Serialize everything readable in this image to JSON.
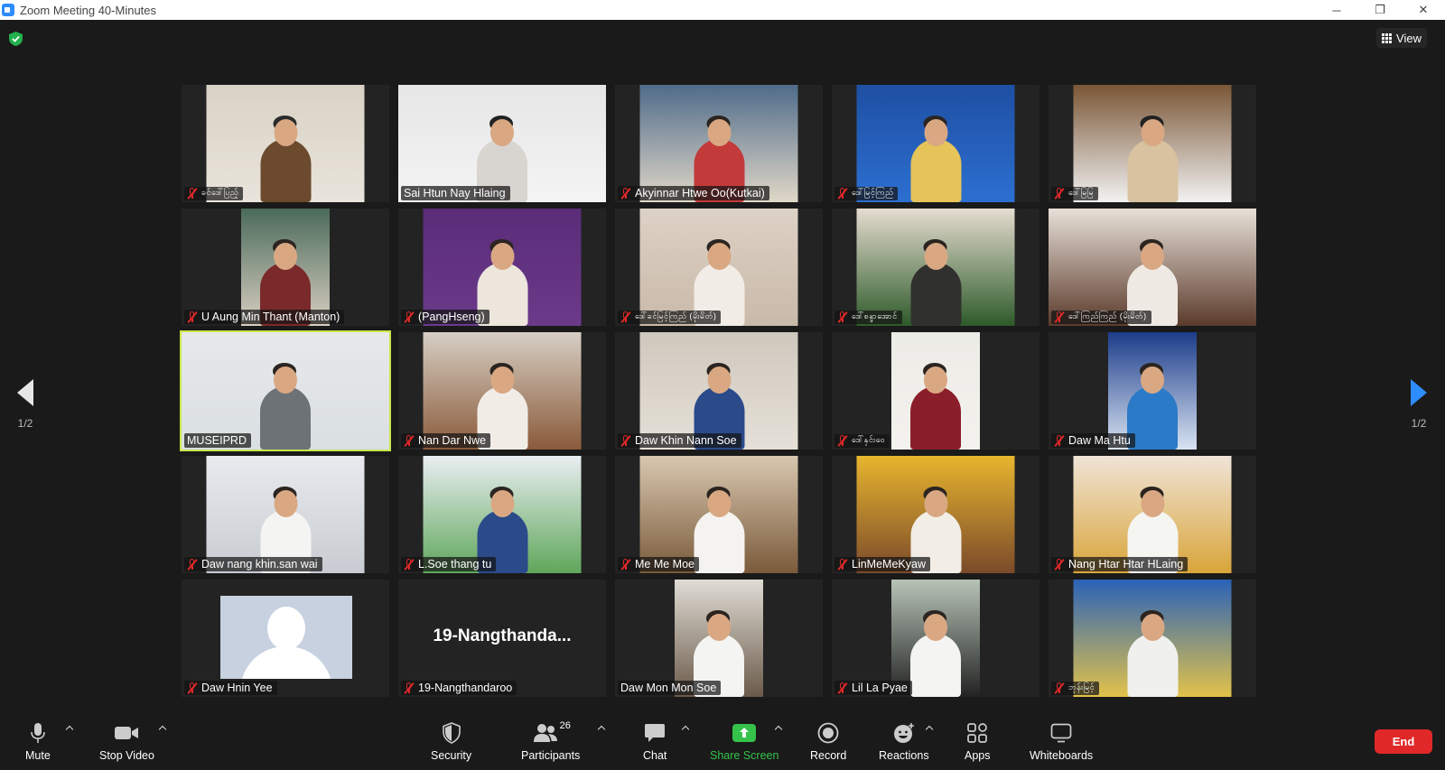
{
  "window": {
    "title": "Zoom Meeting 40-Minutes",
    "minimize": "─",
    "maximize": "❐",
    "close": "✕"
  },
  "header": {
    "view_label": "View"
  },
  "pagination": {
    "left": "1/2",
    "right": "1/2"
  },
  "participants": [
    {
      "name": "ခင်ဒေါ်ပြည့်",
      "muted": true,
      "script": true
    },
    {
      "name": "Sai Htun Nay Hlaing",
      "muted": false
    },
    {
      "name": "Akyinnar Htwe Oo(Kutkai)",
      "muted": true
    },
    {
      "name": "ဒေါ်မြင့်ကြည်",
      "muted": true,
      "script": true
    },
    {
      "name": "ဒေါ်မြမြ",
      "muted": true,
      "script": true
    },
    {
      "name": "U Aung Min Thant (Manton)",
      "muted": true
    },
    {
      "name": "(PangHseng)",
      "muted": true
    },
    {
      "name": "ဒေါ်ခင်မြင့်ကြည် (မိုးမိတ်)",
      "muted": true,
      "script": true
    },
    {
      "name": "ဒေါ်စန္ဒာအောင်",
      "muted": true,
      "script": true
    },
    {
      "name": "ဒေါ်ကြည်ကြည် (မိုးမိတ်)",
      "muted": true,
      "script": true
    },
    {
      "name": "MUSEIPRD",
      "muted": false,
      "active": true
    },
    {
      "name": "Nan Dar Nwe",
      "muted": true
    },
    {
      "name": "Daw Khin Nann Soe",
      "muted": true
    },
    {
      "name": "ဒေါ်နှင်းဝေ",
      "muted": true,
      "script": true
    },
    {
      "name": "Daw Ma Htu",
      "muted": true
    },
    {
      "name": "Daw nang khin.san wai",
      "muted": true
    },
    {
      "name": "L.Soe thang tu",
      "muted": true
    },
    {
      "name": "Me Me Moe",
      "muted": true
    },
    {
      "name": "LinMeMeKyaw",
      "muted": true
    },
    {
      "name": "Nang Htar Htar HLaing",
      "muted": true
    },
    {
      "name": "Daw Hnin Yee",
      "muted": true,
      "avatar": true
    },
    {
      "name": "19-Nangthandaroo",
      "muted": true,
      "big_name": "19-Nangthanda..."
    },
    {
      "name": "Daw Mon Mon Soe",
      "muted": false
    },
    {
      "name": "Lil La Pyae",
      "muted": true
    },
    {
      "name": "ဘုန်းမြင့်",
      "muted": true,
      "script": true
    }
  ],
  "toolbar": {
    "mute": "Mute",
    "stop_video": "Stop Video",
    "security": "Security",
    "participants": "Participants",
    "participants_count": "26",
    "chat": "Chat",
    "share_screen": "Share Screen",
    "record": "Record",
    "reactions": "Reactions",
    "apps": "Apps",
    "whiteboards": "Whiteboards",
    "end": "End"
  },
  "colors": {
    "accent_blue": "#2d8cff",
    "share_green": "#35c24a",
    "end_red": "#e02828",
    "active_speaker": "#c9e64b"
  }
}
